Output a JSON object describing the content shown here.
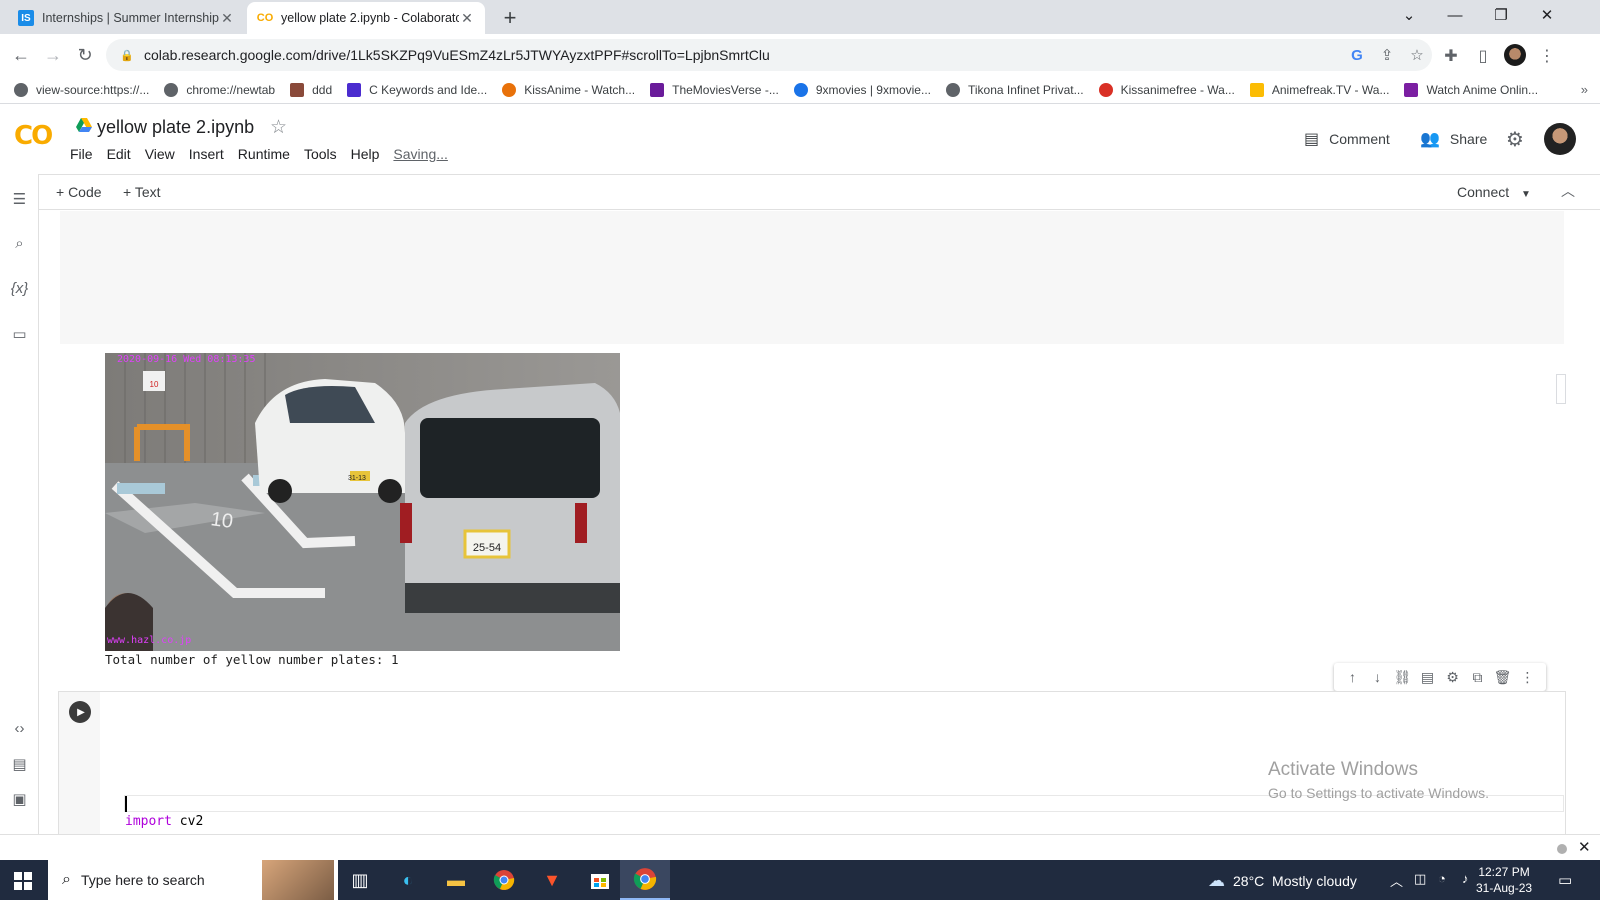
{
  "browser": {
    "tabs": [
      {
        "title": "Internships | Summer Internship 2",
        "favicon": "IS",
        "active": false
      },
      {
        "title": "yellow plate 2.ipynb - Colaborato",
        "favicon": "CO",
        "active": true
      }
    ],
    "new_tab_label": "+",
    "address": "colab.research.google.com/drive/1Lk5SKZPq9VuESmZ4zLr5JTWYAyzxtPPF#scrollTo=LpjbnSmrtClu",
    "bookmarks": [
      {
        "label": "view-source:https://...",
        "color": "#5f6368"
      },
      {
        "label": "chrome://newtab",
        "color": "#5f6368"
      },
      {
        "label": "ddd",
        "color": "#8a4a3a"
      },
      {
        "label": "C Keywords and Ide...",
        "color": "#4b2ccf"
      },
      {
        "label": "KissAnime - Watch...",
        "color": "#e8710a"
      },
      {
        "label": "TheMoviesVerse -...",
        "color": "#6a1b9a"
      },
      {
        "label": "9xmovies | 9xmovie...",
        "color": "#1a73e8"
      },
      {
        "label": "Tikona Infinet Privat...",
        "color": "#5f6368"
      },
      {
        "label": "Kissanimefree - Wa...",
        "color": "#d93025"
      },
      {
        "label": "Animefreak.TV - Wa...",
        "color": "#fbbc04"
      },
      {
        "label": "Watch Anime Onlin...",
        "color": "#7b1fa2"
      }
    ],
    "bookmarks_more": "»"
  },
  "colab": {
    "logo": "CO",
    "notebook_title": "yellow plate 2.ipynb",
    "menu": [
      "File",
      "Edit",
      "View",
      "Insert",
      "Runtime",
      "Tools",
      "Help"
    ],
    "saving_status": "Saving...",
    "comment_label": "Comment",
    "share_label": "Share",
    "add_code_label": "+ Code",
    "add_text_label": "+ Text",
    "connect_label": "Connect",
    "output_text": "Total number of yellow number plates: 1",
    "image_overlay": {
      "timestamp": "2020-09-16 Wed 08:13:35",
      "plate_front": "31-13",
      "plate_rear": "25-54",
      "watermark": "www.hazl.co.jp",
      "parking_number": "10"
    },
    "code_keyword": "import",
    "code_rest": " cv2"
  },
  "windows_watermark": {
    "line1": "Activate Windows",
    "line2": "Go to Settings to activate Windows."
  },
  "taskbar": {
    "search_placeholder": "Type here to search",
    "weather": "28°C  Mostly cloudy",
    "time": "12:27 PM",
    "date": "31-Aug-23"
  }
}
